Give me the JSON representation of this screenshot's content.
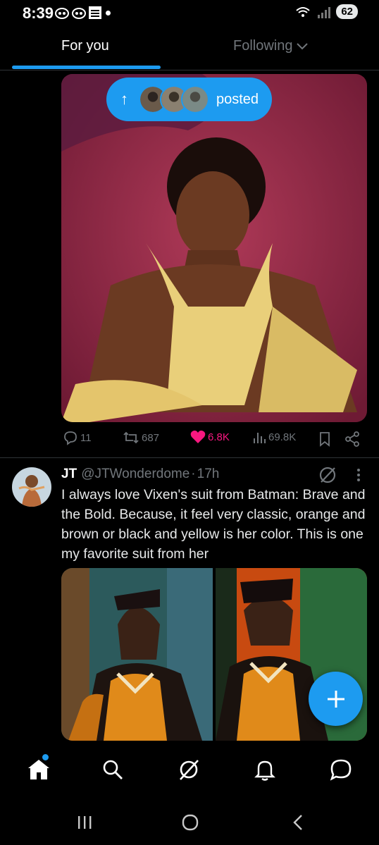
{
  "status_bar": {
    "time": "8:39",
    "battery": "62",
    "weather_app_label": "The Weather Channel"
  },
  "tabs": {
    "for_you": "For you",
    "following": "Following"
  },
  "posted_pill": {
    "label": "posted"
  },
  "post1": {
    "replies": "11",
    "reposts": "687",
    "likes": "6.8K",
    "views": "69.8K"
  },
  "post2": {
    "author_name": "JT",
    "author_handle": "@JTWonderdome",
    "separator": "·",
    "time": "17h",
    "text": "I always love Vixen's suit from Batman: Brave and the Bold. Because, it feel very classic, orange and brown or black and yellow is her color. This is one my favorite suit from her"
  },
  "colors": {
    "accent": "#1d9bf0",
    "like": "#f91880",
    "muted": "#71767b",
    "background": "#000000"
  },
  "icons": {
    "reply": "reply-icon",
    "repost": "repost-icon",
    "like": "heart-icon",
    "views": "views-icon",
    "bookmark": "bookmark-icon",
    "share": "share-icon",
    "grok": "grok-icon",
    "more": "more-icon",
    "compose": "plus-icon",
    "home": "home-icon",
    "search": "search-icon",
    "notifications": "bell-icon",
    "messages": "message-icon"
  }
}
